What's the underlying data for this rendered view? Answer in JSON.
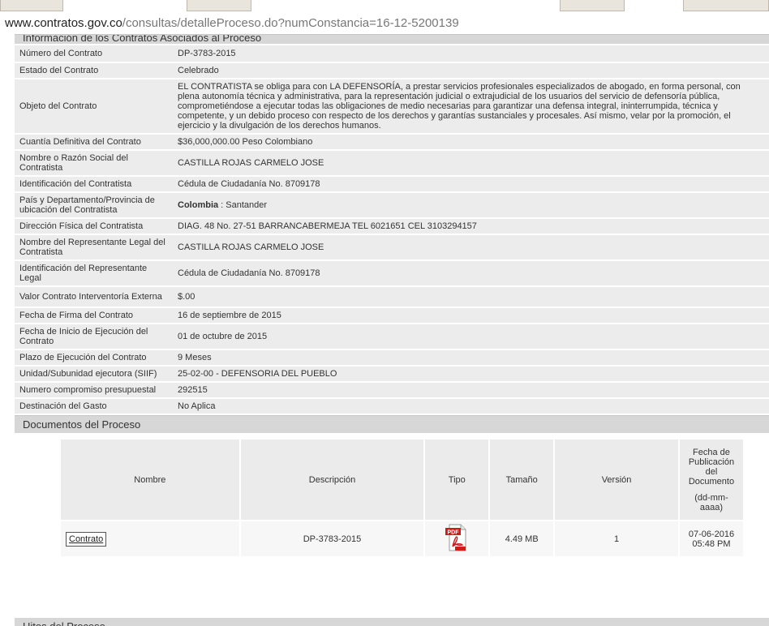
{
  "browser": {
    "url_host": "www.contratos.gov.co",
    "url_path": "/consultas/detalleProceso.do?numConstancia=16-12-5200139"
  },
  "info_section": {
    "title": "Información de los Contratos Asociados al Proceso",
    "rows": [
      {
        "label": "Número del Contrato",
        "value": "DP-3783-2015"
      },
      {
        "label": "Estado del Contrato",
        "value": "Celebrado"
      },
      {
        "label": "Objeto del Contrato",
        "value": "EL CONTRATISTA se obliga para con LA DEFENSORÍA, a prestar servicios profesionales especializados de abogado, en forma personal, con plena autonomía técnica y administrativa, para la representación judicial o extrajudicial de los usuarios del servicio de defensoría pública, comprometiéndose a ejecutar todas las obligaciones de medio necesarias para garantizar una defensa integral, ininterrumpida, técnica y competente, y un debido proceso con respecto de los derechos y garantías sustanciales y procesales. Así mismo, velar por la promoción, el ejercicio y la divulgación de los derechos humanos."
      },
      {
        "label": "Cuantía Definitiva del Contrato",
        "value": "$36,000,000.00 Peso Colombiano"
      },
      {
        "label": "Nombre o Razón Social del Contratista",
        "value": "CASTILLA ROJAS CARMELO JOSE"
      },
      {
        "label": "Identificación del Contratista",
        "value": "Cédula de Ciudadanía No. 8709178"
      },
      {
        "label": "País y Departamento/Provincia de ubicación del Contratista",
        "value_bold": "Colombia",
        "value": " : Santander"
      },
      {
        "label": "Dirección Física del Contratista",
        "value": "DIAG. 48 No. 27-51 BARRANCABERMEJA TEL 6021651 CEL 3103294157"
      },
      {
        "label": "Nombre del Representante Legal del Contratista",
        "value": "CASTILLA ROJAS CARMELO JOSE"
      },
      {
        "label": "Identificación del Representante Legal",
        "value": "Cédula de Ciudadanía No. 8709178"
      },
      {
        "label": "Valor Contrato Interventoría Externa",
        "value": "$.00"
      },
      {
        "label": "Fecha de Firma del Contrato",
        "value": "16 de septiembre de 2015"
      },
      {
        "label": "Fecha de Inicio de Ejecución del Contrato",
        "value": "01 de octubre de 2015"
      },
      {
        "label": "Plazo de Ejecución del Contrato",
        "value": "9 Meses"
      },
      {
        "label": "Unidad/Subunidad ejecutora (SIIF)",
        "value": "25-02-00 - DEFENSORIA DEL PUEBLO"
      },
      {
        "label": "Numero compromiso presupuestal",
        "value": "292515"
      },
      {
        "label": "Destinación del Gasto",
        "value": "No Aplica"
      }
    ]
  },
  "documents": {
    "title": "Documentos del Proceso",
    "headers": {
      "nombre": "Nombre",
      "descripcion": "Descripción",
      "tipo": "Tipo",
      "tamano": "Tamaño",
      "version": "Versión",
      "fecha": "Fecha de Publicación del Documento",
      "fecha_format": "(dd-mm-aaaa)"
    },
    "rows": [
      {
        "nombre": "Contrato",
        "descripcion": "DP-3783-2015",
        "tipo_icon": "pdf-icon",
        "tamano": "4.49 MB",
        "version": "1",
        "fecha": "07-06-2016",
        "hora": "05:48 PM"
      }
    ]
  },
  "next_section": {
    "title": "Hitos del Proceso"
  },
  "colors": {
    "row_bg": "#ececec",
    "header_bg": "#d7d7d7",
    "pdf_red": "#d11a1a"
  }
}
